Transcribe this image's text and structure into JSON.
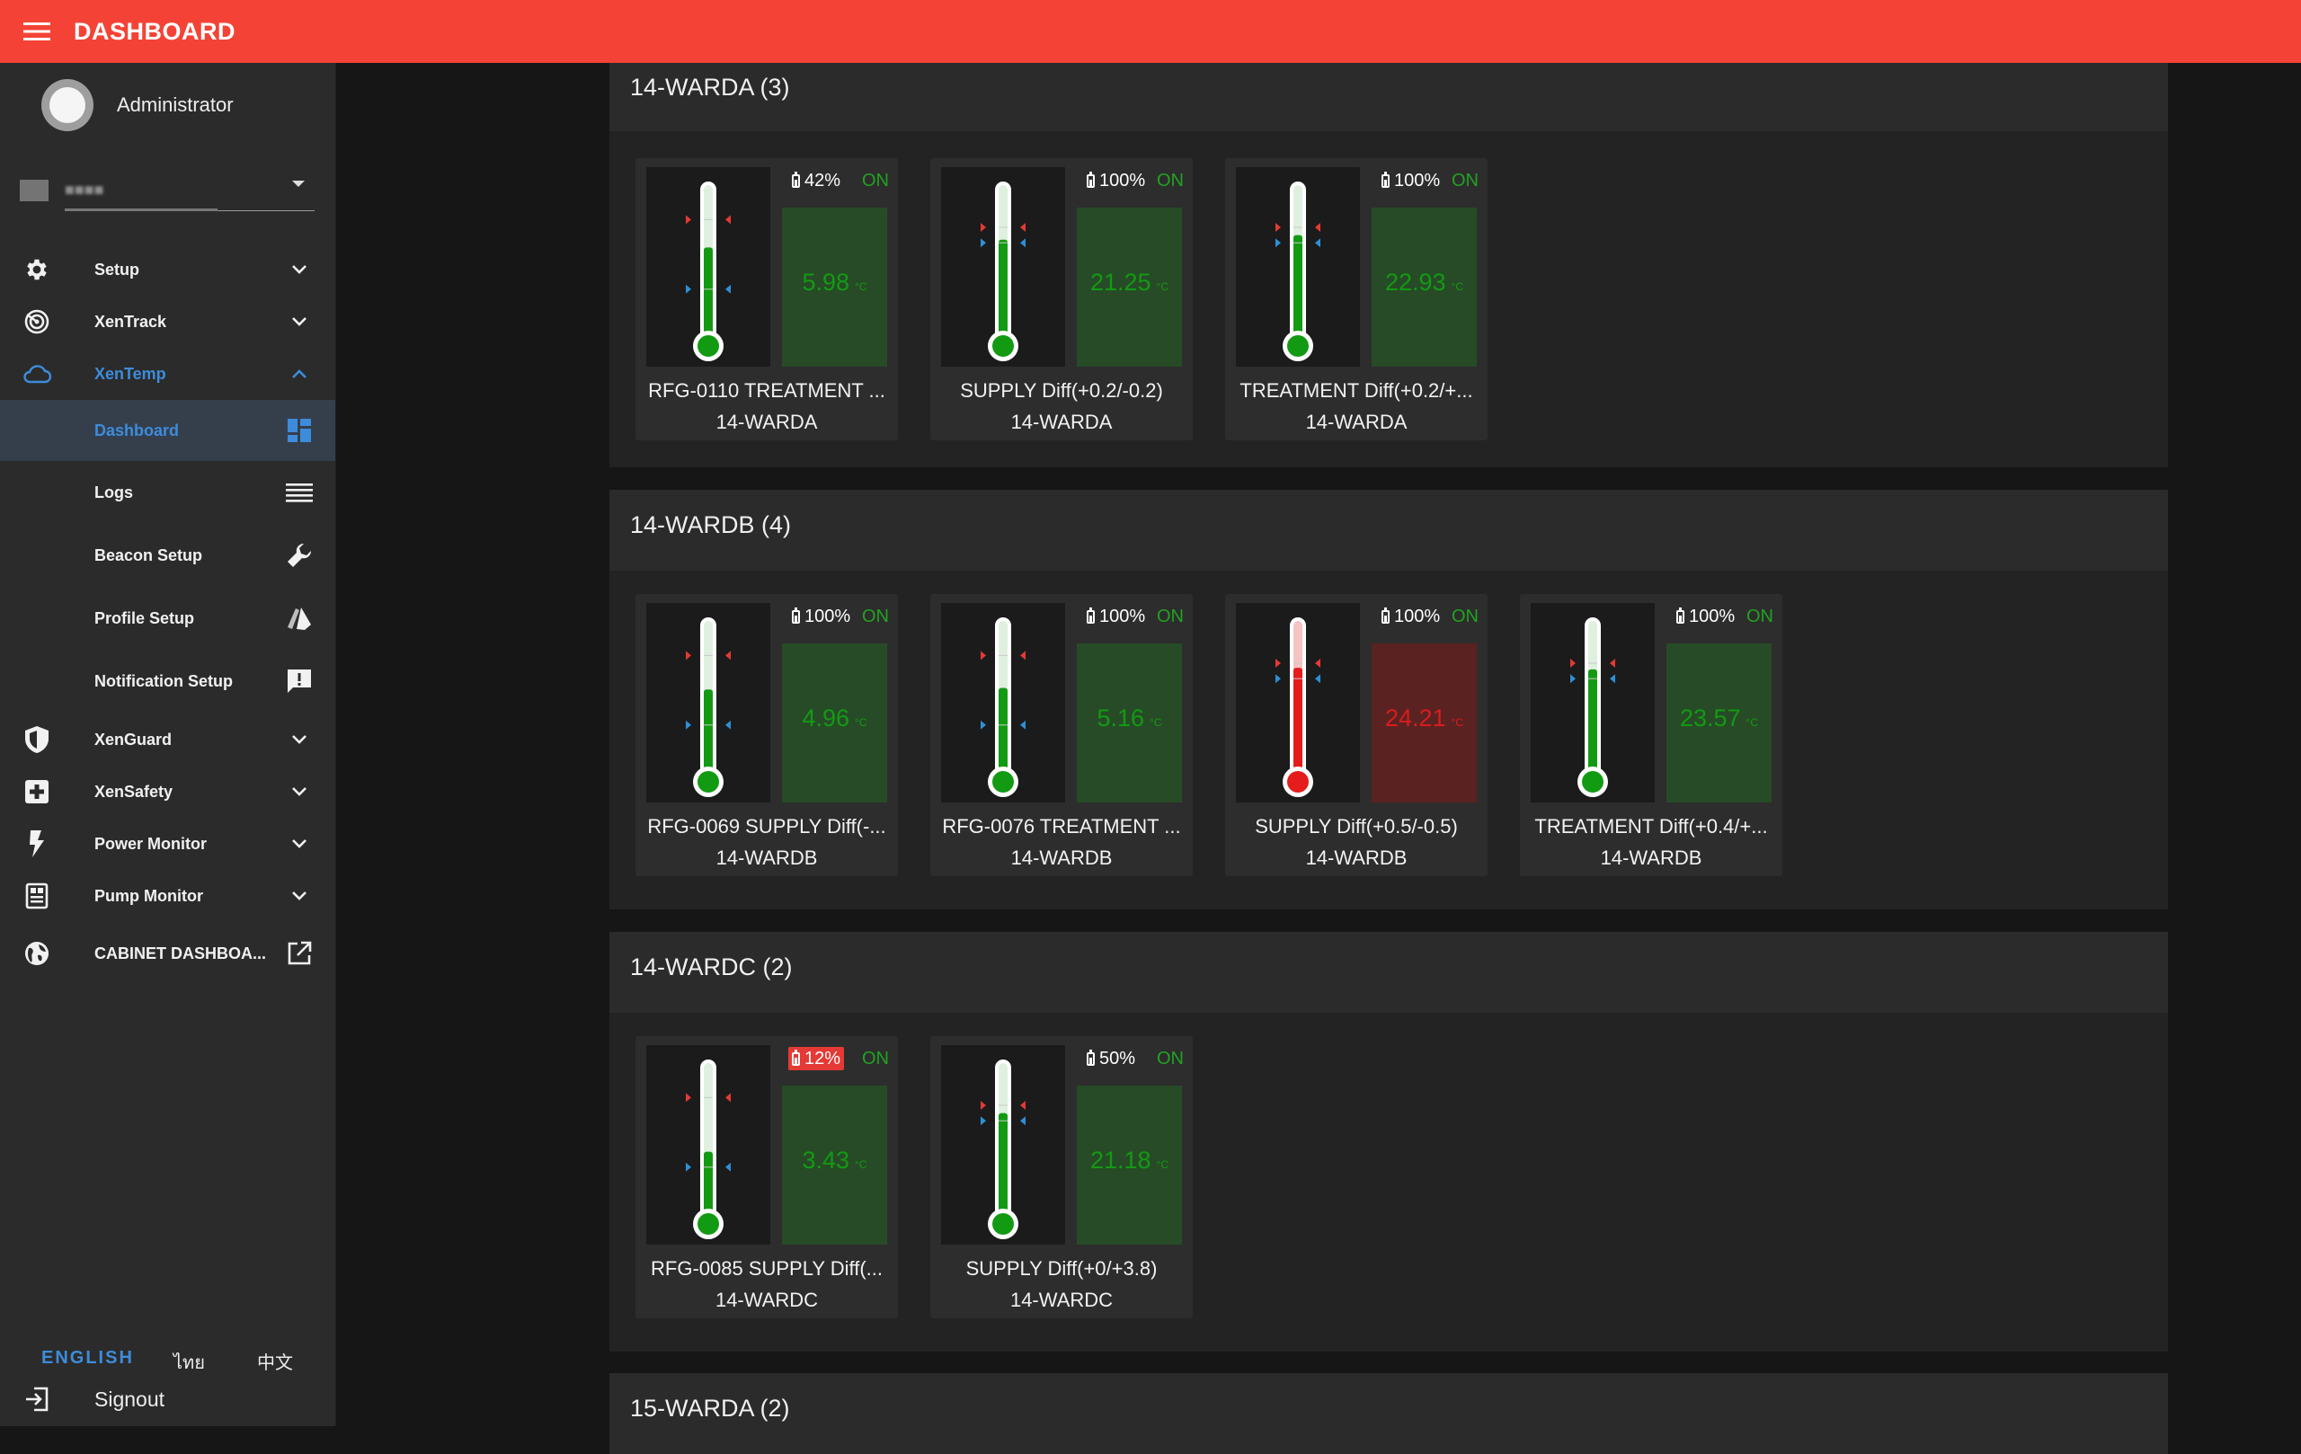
{
  "header": {
    "title": "DASHBOARD"
  },
  "user": {
    "name": "Administrator"
  },
  "org_select": {
    "value": "■■■■"
  },
  "nav": {
    "setup": "Setup",
    "xentrack": "XenTrack",
    "xentemp": "XenTemp",
    "dashboard": "Dashboard",
    "logs": "Logs",
    "beacon_setup": "Beacon Setup",
    "profile_setup": "Profile Setup",
    "notification_setup": "Notification Setup",
    "xenguard": "XenGuard",
    "xensafety": "XenSafety",
    "power_monitor": "Power Monitor",
    "pump_monitor": "Pump Monitor",
    "cabinet_dashboard": "CABINET DASHBOA..."
  },
  "languages": {
    "english": "ENGLISH",
    "thai": "ไทย",
    "chinese": "中文"
  },
  "signout": "Signout",
  "colors": {
    "header": "#f44336",
    "accent": "#3d8cdb",
    "normal": "#139a13",
    "alarm": "#e51c1c",
    "status_on": "#21a321"
  },
  "icons": {
    "menu": "hamburger-menu-icon",
    "setup": "gear-icon",
    "xentrack": "radar-icon",
    "xentemp": "cloud-icon",
    "dashboard": "dashboard-grid-icon",
    "logs": "list-lines-icon",
    "beacon": "wrench-icon",
    "profile": "cards-icon",
    "notification": "message-alert-icon",
    "xenguard": "shield-icon",
    "xensafety": "medical-cross-icon",
    "power": "lightning-bolt-icon",
    "pump": "pump-panel-icon",
    "cabinet": "globe-icon",
    "open": "open-external-icon",
    "signout": "sign-out-icon",
    "battery": "battery-icon"
  },
  "groups": [
    {
      "title": "14-WARDA (3)",
      "sensors": [
        {
          "name": "RFG-0110 TREATMENT ...",
          "ward": "14-WARDA",
          "battery": "42%",
          "battery_low": false,
          "status": "ON",
          "temp": "5.98",
          "unit": "°C",
          "level": 0.62,
          "alarm": false,
          "high_marker": 0.8,
          "low_marker": 0.35
        },
        {
          "name": "SUPPLY Diff(+0.2/-0.2)",
          "ward": "14-WARDA",
          "battery": "100%",
          "battery_low": false,
          "status": "ON",
          "temp": "21.25",
          "unit": "°C",
          "level": 0.67,
          "alarm": false,
          "high_marker": 0.75,
          "low_marker": 0.65
        },
        {
          "name": "TREATMENT Diff(+0.2/+...",
          "ward": "14-WARDA",
          "battery": "100%",
          "battery_low": false,
          "status": "ON",
          "temp": "22.93",
          "unit": "°C",
          "level": 0.7,
          "alarm": false,
          "high_marker": 0.75,
          "low_marker": 0.65
        }
      ]
    },
    {
      "title": "14-WARDB (4)",
      "sensors": [
        {
          "name": "RFG-0069 SUPPLY Diff(-...",
          "ward": "14-WARDB",
          "battery": "100%",
          "battery_low": false,
          "status": "ON",
          "temp": "4.96",
          "unit": "°C",
          "level": 0.58,
          "alarm": false,
          "high_marker": 0.8,
          "low_marker": 0.35
        },
        {
          "name": "RFG-0076 TREATMENT ...",
          "ward": "14-WARDB",
          "battery": "100%",
          "battery_low": false,
          "status": "ON",
          "temp": "5.16",
          "unit": "°C",
          "level": 0.59,
          "alarm": false,
          "high_marker": 0.8,
          "low_marker": 0.35
        },
        {
          "name": "SUPPLY Diff(+0.5/-0.5)",
          "ward": "14-WARDB",
          "battery": "100%",
          "battery_low": false,
          "status": "ON",
          "temp": "24.21",
          "unit": "°C",
          "level": 0.72,
          "alarm": true,
          "high_marker": 0.75,
          "low_marker": 0.65
        },
        {
          "name": "TREATMENT Diff(+0.4/+...",
          "ward": "14-WARDB",
          "battery": "100%",
          "battery_low": false,
          "status": "ON",
          "temp": "23.57",
          "unit": "°C",
          "level": 0.71,
          "alarm": false,
          "high_marker": 0.75,
          "low_marker": 0.65
        }
      ]
    },
    {
      "title": "14-WARDC (2)",
      "sensors": [
        {
          "name": "RFG-0085 SUPPLY Diff(...",
          "ward": "14-WARDC",
          "battery": "12%",
          "battery_low": true,
          "status": "ON",
          "temp": "3.43",
          "unit": "°C",
          "level": 0.45,
          "alarm": false,
          "high_marker": 0.8,
          "low_marker": 0.35
        },
        {
          "name": "SUPPLY Diff(+0/+3.8)",
          "ward": "14-WARDC",
          "battery": "50%",
          "battery_low": false,
          "status": "ON",
          "temp": "21.18",
          "unit": "°C",
          "level": 0.7,
          "alarm": false,
          "high_marker": 0.75,
          "low_marker": 0.65
        }
      ]
    },
    {
      "title": "15-WARDA (2)",
      "sensors": []
    }
  ]
}
